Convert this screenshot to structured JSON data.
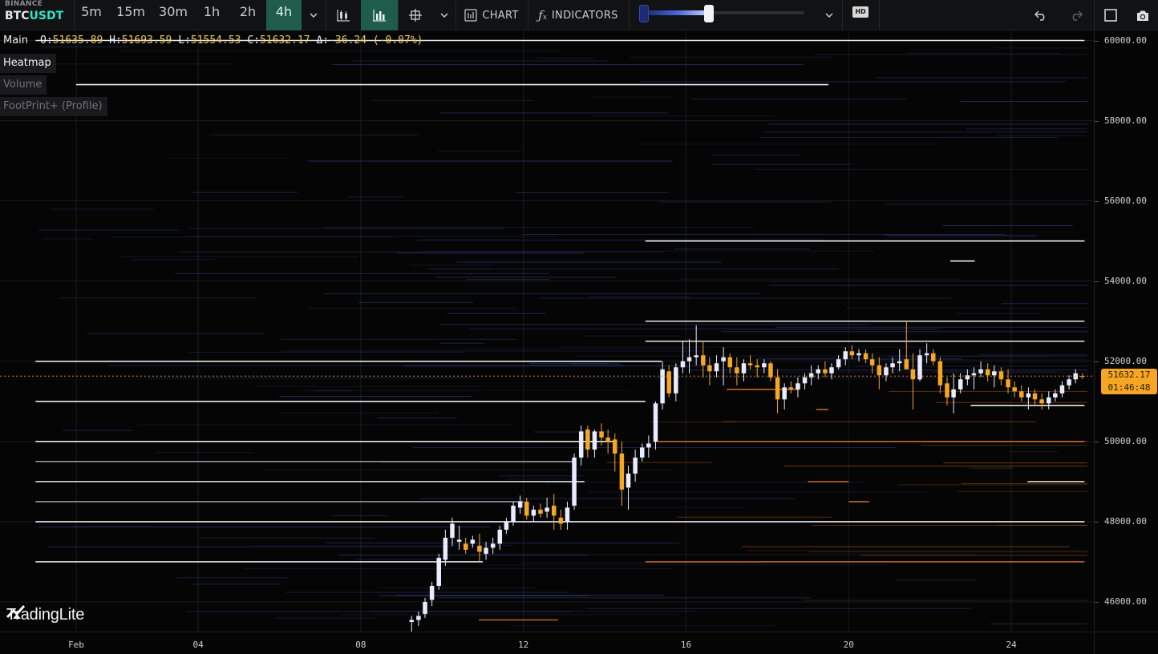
{
  "toolbar": {
    "exchange": "BINANCE",
    "symbol_base": "BTC",
    "symbol_quote": "USDT",
    "timeframes": [
      "5m",
      "15m",
      "30m",
      "1h",
      "2h",
      "4h"
    ],
    "active_timeframe": "4h",
    "chart_label": "CHART",
    "indicators_label": "INDICATORS",
    "hd_label": "HD",
    "heatmap_intensity": 0.4
  },
  "legend": {
    "main_label": "Main",
    "o_key": "O:",
    "o_val": "51635.89",
    "h_key": "H:",
    "h_val": "51693.59",
    "l_key": "L:",
    "l_val": "51554.53",
    "c_key": "C:",
    "c_val": "51632.17",
    "d_key": "Δ:",
    "d_val": "-36.24 (-0.07%)"
  },
  "layers": [
    {
      "label": "Heatmap",
      "enabled": true
    },
    {
      "label": "Volume",
      "enabled": false
    },
    {
      "label": "FootPrint+ (Profile)",
      "enabled": false
    }
  ],
  "watermark": "TradingLite",
  "last_price": {
    "price": "51632.17",
    "countdown": "01:46:48"
  },
  "price_axis": [
    "60000.00",
    "58000.00",
    "56000.00",
    "54000.00",
    "52000.00",
    "50000.00",
    "48000.00",
    "46000.00"
  ],
  "time_axis": [
    "Feb",
    "04",
    "08",
    "12",
    "16",
    "20",
    "24"
  ],
  "colors": {
    "bull": "#e9ecff",
    "bear": "#f5a623",
    "heat_blue": "#3e4a9e",
    "heat_orange": "#c8641e",
    "accent": "#1f5c4c"
  },
  "chart_data": {
    "type": "candlestick",
    "ylim": [
      45400,
      60150
    ],
    "x_ticks": [
      {
        "label": "Feb",
        "day": 1
      },
      {
        "label": "04",
        "day": 4
      },
      {
        "label": "08",
        "day": 8
      },
      {
        "label": "12",
        "day": 12
      },
      {
        "label": "16",
        "day": 16
      },
      {
        "label": "20",
        "day": 20
      },
      {
        "label": "24",
        "day": 24
      }
    ],
    "xlim_days": [
      0.0,
      25.9
    ],
    "candles": [
      [
        9.25,
        45500,
        45650,
        45250,
        45550
      ],
      [
        9.42,
        45550,
        45760,
        45400,
        45650
      ],
      [
        9.58,
        45700,
        46100,
        45600,
        46000
      ],
      [
        9.75,
        46050,
        46500,
        45900,
        46400
      ],
      [
        9.92,
        46400,
        47200,
        46300,
        47100
      ],
      [
        10.08,
        47050,
        47800,
        46900,
        47600
      ],
      [
        10.25,
        47600,
        48100,
        47400,
        47950
      ],
      [
        10.42,
        47500,
        47900,
        47300,
        47550
      ],
      [
        10.58,
        47450,
        47600,
        47200,
        47300
      ],
      [
        10.75,
        47450,
        47650,
        47350,
        47550
      ],
      [
        10.92,
        47400,
        47700,
        47000,
        47250
      ],
      [
        11.08,
        47200,
        47500,
        47050,
        47350
      ],
      [
        11.25,
        47350,
        47600,
        47200,
        47450
      ],
      [
        11.42,
        47450,
        47900,
        47300,
        47800
      ],
      [
        11.58,
        47800,
        48100,
        47700,
        48000
      ],
      [
        11.75,
        48000,
        48500,
        47900,
        48400
      ],
      [
        11.92,
        48350,
        48650,
        48200,
        48500
      ],
      [
        12.08,
        48500,
        48600,
        48050,
        48150
      ],
      [
        12.25,
        48150,
        48400,
        48000,
        48300
      ],
      [
        12.42,
        48300,
        48450,
        48100,
        48200
      ],
      [
        12.58,
        48250,
        48600,
        48100,
        48350
      ],
      [
        12.75,
        48400,
        48700,
        47800,
        48150
      ],
      [
        12.92,
        48100,
        48300,
        47800,
        47950
      ],
      [
        13.08,
        48000,
        48500,
        47800,
        48350
      ],
      [
        13.25,
        48400,
        49700,
        48300,
        49600
      ],
      [
        13.42,
        49600,
        50400,
        49400,
        50250
      ],
      [
        13.58,
        50300,
        50400,
        49600,
        49800
      ],
      [
        13.75,
        49800,
        50300,
        49600,
        50250
      ],
      [
        13.92,
        50250,
        50450,
        49900,
        50100
      ],
      [
        14.08,
        50100,
        50300,
        49700,
        50000
      ],
      [
        14.25,
        50050,
        50200,
        49250,
        49700
      ],
      [
        14.42,
        49700,
        50000,
        48400,
        48800
      ],
      [
        14.58,
        48850,
        49400,
        48300,
        49200
      ],
      [
        14.75,
        49200,
        49800,
        49000,
        49600
      ],
      [
        14.92,
        49600,
        49950,
        49500,
        49850
      ],
      [
        15.08,
        49850,
        50150,
        49600,
        49950
      ],
      [
        15.25,
        50000,
        51000,
        49800,
        50950
      ],
      [
        15.42,
        50950,
        52000,
        50800,
        51800
      ],
      [
        15.58,
        51750,
        51900,
        51100,
        51200
      ],
      [
        15.75,
        51200,
        51950,
        51000,
        51850
      ],
      [
        15.92,
        51850,
        52500,
        51700,
        52000
      ],
      [
        16.08,
        52000,
        52550,
        51700,
        52100
      ],
      [
        16.25,
        52100,
        52900,
        51900,
        52150
      ],
      [
        16.42,
        52150,
        52500,
        51600,
        51900
      ],
      [
        16.58,
        51900,
        52100,
        51400,
        51750
      ],
      [
        16.75,
        51750,
        52150,
        51600,
        51950
      ],
      [
        16.92,
        52000,
        52350,
        51400,
        52100
      ],
      [
        17.08,
        52100,
        52200,
        51700,
        51850
      ],
      [
        17.25,
        51850,
        52100,
        51400,
        51700
      ],
      [
        17.42,
        51700,
        52050,
        51500,
        51950
      ],
      [
        17.58,
        51950,
        52150,
        51800,
        51900
      ],
      [
        17.75,
        51900,
        52050,
        51600,
        51850
      ],
      [
        17.92,
        51850,
        52050,
        51700,
        51950
      ],
      [
        18.08,
        51950,
        52000,
        51500,
        51600
      ],
      [
        18.25,
        51600,
        51800,
        50700,
        51050
      ],
      [
        18.42,
        51050,
        51450,
        50800,
        51350
      ],
      [
        18.58,
        51350,
        51500,
        51200,
        51300
      ],
      [
        18.75,
        51300,
        51600,
        51100,
        51450
      ],
      [
        18.92,
        51450,
        51700,
        51300,
        51600
      ],
      [
        19.08,
        51600,
        51900,
        51400,
        51700
      ],
      [
        19.25,
        51700,
        51900,
        51550,
        51800
      ],
      [
        19.42,
        51800,
        52000,
        51600,
        51700
      ],
      [
        19.58,
        51700,
        51950,
        51550,
        51850
      ],
      [
        19.75,
        51850,
        52150,
        51800,
        52050
      ],
      [
        19.92,
        52050,
        52350,
        51900,
        52250
      ],
      [
        20.08,
        52250,
        52400,
        52050,
        52150
      ],
      [
        20.25,
        52150,
        52300,
        52000,
        52200
      ],
      [
        20.42,
        52200,
        52300,
        51950,
        52050
      ],
      [
        20.58,
        52050,
        52200,
        51700,
        51900
      ],
      [
        20.75,
        51900,
        52100,
        51300,
        51650
      ],
      [
        20.92,
        51650,
        51950,
        51500,
        51850
      ],
      [
        21.08,
        51850,
        52100,
        51700,
        51950
      ],
      [
        21.25,
        51950,
        52300,
        51750,
        52000
      ],
      [
        21.42,
        52050,
        53000,
        51850,
        51800
      ],
      [
        21.58,
        51800,
        52200,
        50800,
        51550
      ],
      [
        21.75,
        51550,
        52300,
        51500,
        52150
      ],
      [
        21.92,
        52150,
        52450,
        51950,
        52200
      ],
      [
        22.08,
        52200,
        52300,
        51900,
        52000
      ],
      [
        22.25,
        52000,
        52100,
        51200,
        51400
      ],
      [
        22.42,
        51450,
        51600,
        50900,
        51100
      ],
      [
        22.58,
        51100,
        51700,
        50700,
        51300
      ],
      [
        22.75,
        51300,
        51700,
        51200,
        51550
      ],
      [
        22.92,
        51550,
        51800,
        51400,
        51650
      ],
      [
        23.08,
        51650,
        51850,
        51300,
        51700
      ],
      [
        23.25,
        51700,
        52000,
        51600,
        51800
      ],
      [
        23.42,
        51800,
        51950,
        51500,
        51650
      ],
      [
        23.58,
        51650,
        51900,
        51350,
        51750
      ],
      [
        23.75,
        51750,
        51850,
        51400,
        51550
      ],
      [
        23.92,
        51550,
        51800,
        51200,
        51350
      ],
      [
        24.08,
        51350,
        51500,
        51100,
        51250
      ],
      [
        24.25,
        51250,
        51400,
        51000,
        51100
      ],
      [
        24.42,
        51100,
        51350,
        50800,
        51200
      ],
      [
        24.58,
        51200,
        51300,
        50900,
        51050
      ],
      [
        24.75,
        51050,
        51200,
        50800,
        50950
      ],
      [
        24.92,
        50950,
        51250,
        50800,
        51100
      ],
      [
        25.08,
        51100,
        51300,
        51000,
        51200
      ],
      [
        25.25,
        51200,
        51500,
        51100,
        51400
      ],
      [
        25.42,
        51400,
        51650,
        51300,
        51550
      ],
      [
        25.58,
        51550,
        51800,
        51450,
        51700
      ],
      [
        25.75,
        51636,
        51694,
        51555,
        51632
      ]
    ],
    "liquidity_lines": [
      {
        "price": 60000,
        "from_day": 0.0,
        "to_day": 25.8,
        "intensity": "high"
      },
      {
        "price": 58900,
        "from_day": 1.0,
        "to_day": 19.5,
        "intensity": "high"
      },
      {
        "price": 55000,
        "from_day": 15.0,
        "to_day": 25.8,
        "intensity": "high"
      },
      {
        "price": 54500,
        "from_day": 22.5,
        "to_day": 23.1,
        "intensity": "high"
      },
      {
        "price": 53000,
        "from_day": 15.0,
        "to_day": 25.8,
        "intensity": "high"
      },
      {
        "price": 52500,
        "from_day": 15.0,
        "to_day": 25.8,
        "intensity": "high"
      },
      {
        "price": 52000,
        "from_day": 0.0,
        "to_day": 15.4,
        "intensity": "high"
      },
      {
        "price": 51000,
        "from_day": 0.0,
        "to_day": 15.0,
        "intensity": "high"
      },
      {
        "price": 50000,
        "from_day": 0.0,
        "to_day": 14.3,
        "intensity": "high"
      },
      {
        "price": 49500,
        "from_day": 0.0,
        "to_day": 13.2,
        "intensity": "medium"
      },
      {
        "price": 49000,
        "from_day": 0.0,
        "to_day": 13.5,
        "intensity": "high"
      },
      {
        "price": 48500,
        "from_day": 0.0,
        "to_day": 12.0,
        "intensity": "medium"
      },
      {
        "price": 48000,
        "from_day": 0.0,
        "to_day": 25.8,
        "intensity": "high"
      },
      {
        "price": 47000,
        "from_day": 0.0,
        "to_day": 11.0,
        "intensity": "high"
      },
      {
        "price": 49000,
        "from_day": 24.4,
        "to_day": 25.8,
        "intensity": "high"
      },
      {
        "price": 50900,
        "from_day": 23.0,
        "to_day": 25.8,
        "intensity": "high"
      }
    ],
    "bid_zones": [
      {
        "price": 51300,
        "from_day": 17.0,
        "to_day": 18.8
      },
      {
        "price": 50800,
        "from_day": 19.2,
        "to_day": 19.5
      },
      {
        "price": 50000,
        "from_day": 15.2,
        "to_day": 25.8
      },
      {
        "price": 49000,
        "from_day": 19.0,
        "to_day": 20.0
      },
      {
        "price": 48500,
        "from_day": 20.0,
        "to_day": 20.5
      },
      {
        "price": 47000,
        "from_day": 15.0,
        "to_day": 25.8
      },
      {
        "price": 45550,
        "from_day": 10.9,
        "to_day": 12.85
      }
    ]
  }
}
